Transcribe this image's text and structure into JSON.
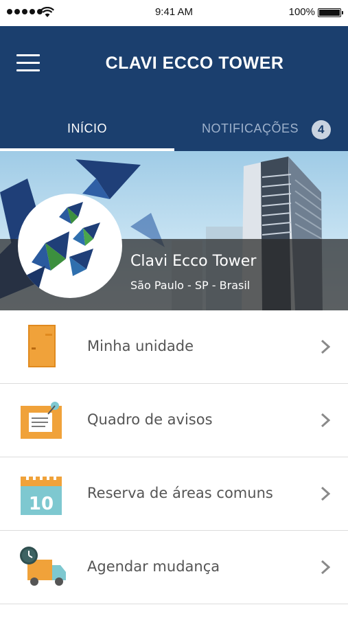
{
  "status_bar": {
    "time": "9:41 AM",
    "battery": "100%",
    "icons": [
      "signal-icon",
      "wifi-icon",
      "battery-icon"
    ]
  },
  "header": {
    "title": "CLAVI ECCO TOWER",
    "menu_icon": "hamburger-menu-icon"
  },
  "tabs": [
    {
      "label": "INÍCIO",
      "active": true
    },
    {
      "label": "NOTIFICAÇÕES",
      "active": false,
      "badge": "4"
    }
  ],
  "banner": {
    "name": "Clavi Ecco Tower",
    "location": "São Paulo - SP - Brasil",
    "logo": "butterflies-logo"
  },
  "menu": [
    {
      "label": "Minha unidade",
      "icon": "door-icon"
    },
    {
      "label": "Quadro de avisos",
      "icon": "notice-board-icon"
    },
    {
      "label": "Reserva de áreas comuns",
      "icon": "calendar-icon",
      "icon_text": "10"
    },
    {
      "label": "Agendar mudança",
      "icon": "moving-truck-icon"
    }
  ],
  "colors": {
    "header": "#1b3f6e",
    "active_tab": "#ffffff",
    "inactive_tab": "#9fb2cc",
    "door_orange": "#f0a23a",
    "calendar_teal": "#7ec8d0"
  }
}
